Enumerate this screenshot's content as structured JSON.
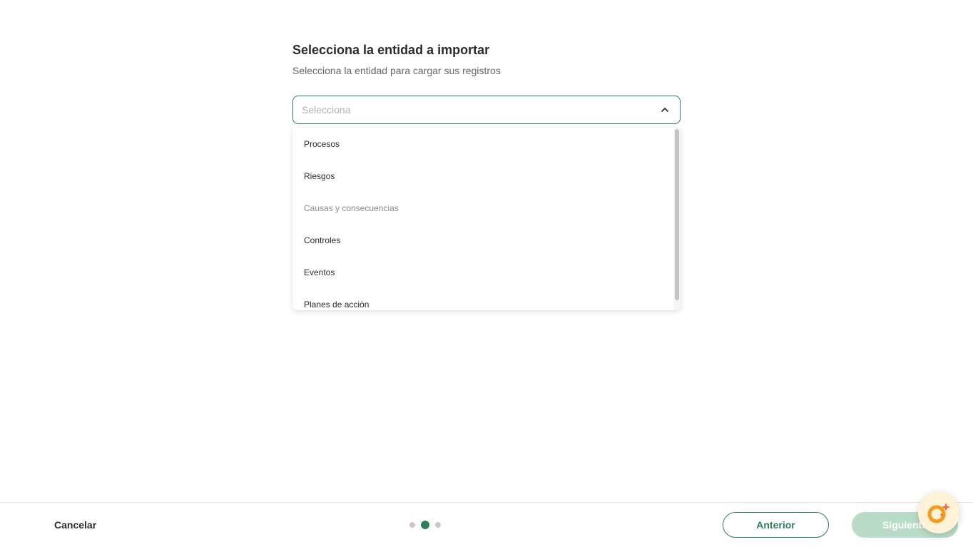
{
  "header": {
    "title": "Selecciona la entidad a importar",
    "subtitle": "Selecciona la entidad para cargar sus registros"
  },
  "entity_select": {
    "placeholder": "Selecciona",
    "expanded": true,
    "options": [
      {
        "label": "Procesos",
        "disabled": false
      },
      {
        "label": "Riesgos",
        "disabled": false
      },
      {
        "label": "Causas y consecuencias",
        "disabled": true
      },
      {
        "label": "Controles",
        "disabled": false
      },
      {
        "label": "Eventos",
        "disabled": false
      },
      {
        "label": "Planes de acción",
        "disabled": false
      }
    ]
  },
  "footer": {
    "cancel_label": "Cancelar",
    "steps": {
      "total": 3,
      "current": 2
    },
    "prev_label": "Anterior",
    "next_label": "Siguiente",
    "next_disabled": true
  },
  "assistant": {
    "icon": "ai-assistant-icon"
  },
  "colors": {
    "accent": "#2e7d5b",
    "accent_disabled": "#b9dcc8",
    "assistant_bg": "#fff2d6",
    "assistant_orange": "#f39c1f"
  }
}
